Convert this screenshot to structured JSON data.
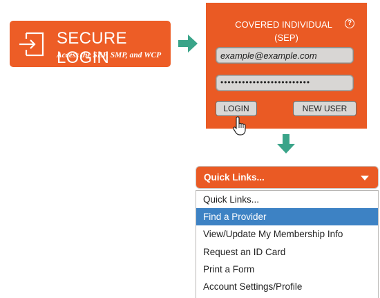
{
  "secure_login": {
    "title": "SECURE LOGIN",
    "subtitle": "Access the SEP, SMP, and WCP",
    "icon": "login-door-icon"
  },
  "login_panel": {
    "header_line1": "COVERED INDIVIDUAL",
    "header_line2": "(SEP)",
    "help_glyph": "?",
    "email_value": "example@example.com",
    "password_value": "•••••••••••••••••••••••••",
    "login_label": "LOGIN",
    "new_user_label": "NEW USER"
  },
  "dropdown": {
    "selected": "Quick Links...",
    "items": [
      "Quick Links...",
      "Find a Provider",
      "View/Update My Membership Info",
      "Request an ID Card",
      "Print a Form",
      "Account Settings/Profile"
    ],
    "highlighted_index": 1
  },
  "colors": {
    "accent": "#ea5a24",
    "arrow": "#3aa489",
    "highlight": "#3d82c4"
  }
}
